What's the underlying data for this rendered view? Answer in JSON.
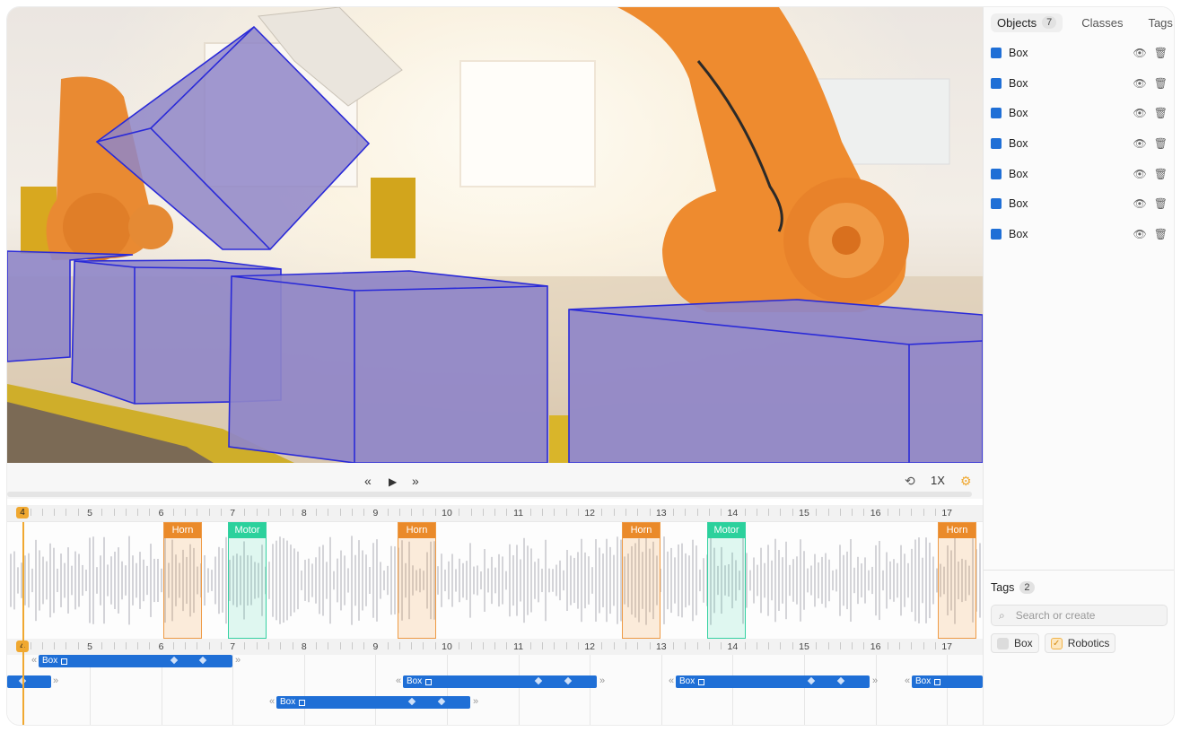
{
  "colors": {
    "accent": "#1f6fd6",
    "playhead": "#f0a830",
    "horn": "#ea8a2a",
    "motor": "#2bd19c",
    "overlay": "#8f86c8",
    "overlay_stroke": "#2a2ad8"
  },
  "tabs": [
    {
      "label": "Objects",
      "count": "7"
    },
    {
      "label": "Classes"
    },
    {
      "label": "Tags"
    }
  ],
  "objects": [
    {
      "label": "Box"
    },
    {
      "label": "Box"
    },
    {
      "label": "Box"
    },
    {
      "label": "Box"
    },
    {
      "label": "Box"
    },
    {
      "label": "Box"
    },
    {
      "label": "Box"
    }
  ],
  "object_icons": [
    "eye-icon",
    "trash-icon"
  ],
  "tags_panel": {
    "title": "Tags",
    "count": "2",
    "search_placeholder": "Search or create",
    "chips": [
      {
        "label": "Box",
        "checked": false
      },
      {
        "label": "Robotics",
        "checked": true
      }
    ]
  },
  "controls": {
    "rewind": "«",
    "play": "▶",
    "forward": "»",
    "speed": "1X"
  },
  "timeline": {
    "current": "4",
    "ticks": [
      "5",
      "6",
      "7",
      "8",
      "9",
      "10",
      "11",
      "12",
      "13",
      "14",
      "15",
      "16",
      "17"
    ]
  },
  "audio_segments": [
    {
      "label": "Horn",
      "kind": "horn"
    },
    {
      "label": "Motor",
      "kind": "motor"
    },
    {
      "label": "Horn",
      "kind": "horn"
    },
    {
      "label": "Horn",
      "kind": "horn"
    },
    {
      "label": "Motor",
      "kind": "motor"
    },
    {
      "label": "Horn",
      "kind": "horn"
    }
  ],
  "object_tracks": [
    {
      "label": "Box"
    },
    {
      "label": ""
    },
    {
      "label": "Box"
    },
    {
      "label": "Box"
    },
    {
      "label": "Box"
    },
    {
      "label": "Box"
    }
  ]
}
